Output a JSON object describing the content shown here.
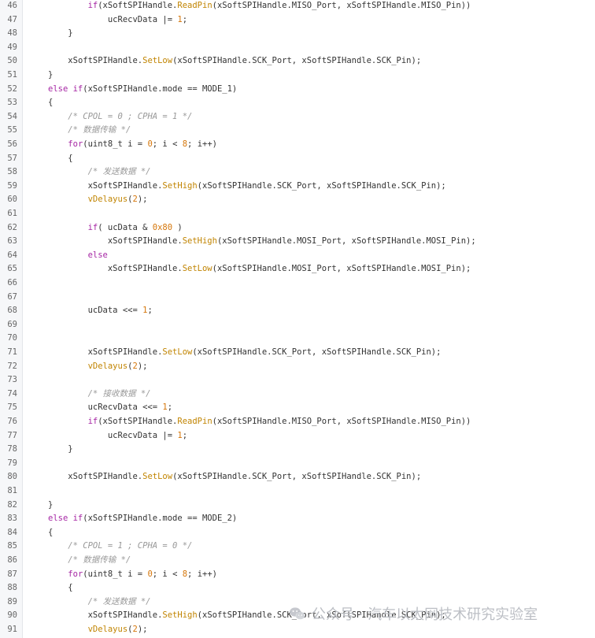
{
  "code_lines": [
    {
      "n": "46",
      "indent": 2,
      "t": [
        [
          "kw",
          "if"
        ],
        [
          "",
          "(xSoftSPIHandle."
        ],
        [
          "fn",
          "ReadPin"
        ],
        [
          "",
          "(xSoftSPIHandle.MISO_Port, xSoftSPIHandle.MISO_Pin))"
        ]
      ]
    },
    {
      "n": "47",
      "indent": 3,
      "t": [
        [
          "",
          "ucRecvData |= "
        ],
        [
          "num",
          "1"
        ],
        [
          "",
          ";"
        ]
      ]
    },
    {
      "n": "48",
      "indent": 1,
      "t": [
        [
          "",
          "}"
        ]
      ]
    },
    {
      "n": "49",
      "indent": 0,
      "t": []
    },
    {
      "n": "50",
      "indent": 1,
      "t": [
        [
          "",
          "xSoftSPIHandle."
        ],
        [
          "fn",
          "SetLow"
        ],
        [
          "",
          "(xSoftSPIHandle.SCK_Port, xSoftSPIHandle.SCK_Pin);"
        ]
      ]
    },
    {
      "n": "51",
      "indent": 0,
      "t": [
        [
          "",
          "}"
        ]
      ]
    },
    {
      "n": "52",
      "indent": 0,
      "t": [
        [
          "kw",
          "else if"
        ],
        [
          "",
          "(xSoftSPIHandle.mode == MODE_1)"
        ]
      ]
    },
    {
      "n": "53",
      "indent": 0,
      "t": [
        [
          "",
          "{"
        ]
      ]
    },
    {
      "n": "54",
      "indent": 1,
      "t": [
        [
          "cm",
          "/* CPOL = 0 ; CPHA = 1 */"
        ]
      ]
    },
    {
      "n": "55",
      "indent": 1,
      "t": [
        [
          "cm",
          "/* 数据传输 */"
        ]
      ]
    },
    {
      "n": "56",
      "indent": 1,
      "t": [
        [
          "kw",
          "for"
        ],
        [
          "",
          "(uint8_t i = "
        ],
        [
          "num",
          "0"
        ],
        [
          "",
          "; i < "
        ],
        [
          "num",
          "8"
        ],
        [
          "",
          "; i++)"
        ]
      ]
    },
    {
      "n": "57",
      "indent": 1,
      "t": [
        [
          "",
          "{"
        ]
      ]
    },
    {
      "n": "58",
      "indent": 2,
      "t": [
        [
          "cm",
          "/* 发送数据 */"
        ]
      ]
    },
    {
      "n": "59",
      "indent": 2,
      "t": [
        [
          "",
          "xSoftSPIHandle."
        ],
        [
          "fn",
          "SetHigh"
        ],
        [
          "",
          "(xSoftSPIHandle.SCK_Port, xSoftSPIHandle.SCK_Pin);"
        ]
      ]
    },
    {
      "n": "60",
      "indent": 2,
      "t": [
        [
          "fn",
          "vDelayus"
        ],
        [
          "",
          "("
        ],
        [
          "num",
          "2"
        ],
        [
          "",
          ");"
        ]
      ]
    },
    {
      "n": "61",
      "indent": 0,
      "t": []
    },
    {
      "n": "62",
      "indent": 2,
      "t": [
        [
          "kw",
          "if"
        ],
        [
          "",
          "( ucData & "
        ],
        [
          "num",
          "0x80"
        ],
        [
          "",
          " )"
        ]
      ]
    },
    {
      "n": "63",
      "indent": 3,
      "t": [
        [
          "",
          "xSoftSPIHandle."
        ],
        [
          "fn",
          "SetHigh"
        ],
        [
          "",
          "(xSoftSPIHandle.MOSI_Port, xSoftSPIHandle.MOSI_Pin);"
        ]
      ]
    },
    {
      "n": "64",
      "indent": 2,
      "t": [
        [
          "kw",
          "else"
        ]
      ]
    },
    {
      "n": "65",
      "indent": 3,
      "t": [
        [
          "",
          "xSoftSPIHandle."
        ],
        [
          "fn",
          "SetLow"
        ],
        [
          "",
          "(xSoftSPIHandle.MOSI_Port, xSoftSPIHandle.MOSI_Pin);"
        ]
      ]
    },
    {
      "n": "66",
      "indent": 0,
      "t": []
    },
    {
      "n": "67",
      "indent": 0,
      "t": []
    },
    {
      "n": "68",
      "indent": 2,
      "t": [
        [
          "",
          "ucData <<= "
        ],
        [
          "num",
          "1"
        ],
        [
          "",
          ";"
        ]
      ]
    },
    {
      "n": "69",
      "indent": 0,
      "t": []
    },
    {
      "n": "70",
      "indent": 0,
      "t": []
    },
    {
      "n": "71",
      "indent": 2,
      "t": [
        [
          "",
          "xSoftSPIHandle."
        ],
        [
          "fn",
          "SetLow"
        ],
        [
          "",
          "(xSoftSPIHandle.SCK_Port, xSoftSPIHandle.SCK_Pin);"
        ]
      ]
    },
    {
      "n": "72",
      "indent": 2,
      "t": [
        [
          "fn",
          "vDelayus"
        ],
        [
          "",
          "("
        ],
        [
          "num",
          "2"
        ],
        [
          "",
          ");"
        ]
      ]
    },
    {
      "n": "73",
      "indent": 0,
      "t": []
    },
    {
      "n": "74",
      "indent": 2,
      "t": [
        [
          "cm",
          "/* 接收数据 */"
        ]
      ]
    },
    {
      "n": "75",
      "indent": 2,
      "t": [
        [
          "",
          "ucRecvData <<= "
        ],
        [
          "num",
          "1"
        ],
        [
          "",
          ";"
        ]
      ]
    },
    {
      "n": "76",
      "indent": 2,
      "t": [
        [
          "kw",
          "if"
        ],
        [
          "",
          "(xSoftSPIHandle."
        ],
        [
          "fn",
          "ReadPin"
        ],
        [
          "",
          "(xSoftSPIHandle.MISO_Port, xSoftSPIHandle.MISO_Pin))"
        ]
      ]
    },
    {
      "n": "77",
      "indent": 3,
      "t": [
        [
          "",
          "ucRecvData |= "
        ],
        [
          "num",
          "1"
        ],
        [
          "",
          ";"
        ]
      ]
    },
    {
      "n": "78",
      "indent": 1,
      "t": [
        [
          "",
          "}"
        ]
      ]
    },
    {
      "n": "79",
      "indent": 0,
      "t": []
    },
    {
      "n": "80",
      "indent": 1,
      "t": [
        [
          "",
          "xSoftSPIHandle."
        ],
        [
          "fn",
          "SetLow"
        ],
        [
          "",
          "(xSoftSPIHandle.SCK_Port, xSoftSPIHandle.SCK_Pin);"
        ]
      ]
    },
    {
      "n": "81",
      "indent": 0,
      "t": []
    },
    {
      "n": "82",
      "indent": 0,
      "t": [
        [
          "",
          "}"
        ]
      ]
    },
    {
      "n": "83",
      "indent": 0,
      "t": [
        [
          "kw",
          "else if"
        ],
        [
          "",
          "(xSoftSPIHandle.mode == MODE_2)"
        ]
      ]
    },
    {
      "n": "84",
      "indent": 0,
      "t": [
        [
          "",
          "{"
        ]
      ]
    },
    {
      "n": "85",
      "indent": 1,
      "t": [
        [
          "cm",
          "/* CPOL = 1 ; CPHA = 0 */"
        ]
      ]
    },
    {
      "n": "86",
      "indent": 1,
      "t": [
        [
          "cm",
          "/* 数据传输 */"
        ]
      ]
    },
    {
      "n": "87",
      "indent": 1,
      "t": [
        [
          "kw",
          "for"
        ],
        [
          "",
          "(uint8_t i = "
        ],
        [
          "num",
          "0"
        ],
        [
          "",
          "; i < "
        ],
        [
          "num",
          "8"
        ],
        [
          "",
          "; i++)"
        ]
      ]
    },
    {
      "n": "88",
      "indent": 1,
      "t": [
        [
          "",
          "{"
        ]
      ]
    },
    {
      "n": "89",
      "indent": 2,
      "t": [
        [
          "cm",
          "/* 发送数据 */"
        ]
      ]
    },
    {
      "n": "90",
      "indent": 2,
      "t": [
        [
          "",
          "xSoftSPIHandle."
        ],
        [
          "fn",
          "SetHigh"
        ],
        [
          "",
          "(xSoftSPIHandle.SCK_Port, xSoftSPIHandle.SCK_Pin);"
        ]
      ]
    },
    {
      "n": "91",
      "indent": 2,
      "t": [
        [
          "fn",
          "vDelayus"
        ],
        [
          "",
          "("
        ],
        [
          "num",
          "2"
        ],
        [
          "",
          ");"
        ]
      ]
    }
  ],
  "watermark": {
    "text": "公众号 · 汽车以太网技术研究实验室",
    "icon": "wechat-icon"
  },
  "colors": {
    "keyword": "#a626a4",
    "function": "#c18401",
    "number": "#d5760a",
    "comment": "#999999",
    "text": "#333333",
    "line_number": "#666666",
    "gutter_bg": "#f6f7f9"
  }
}
